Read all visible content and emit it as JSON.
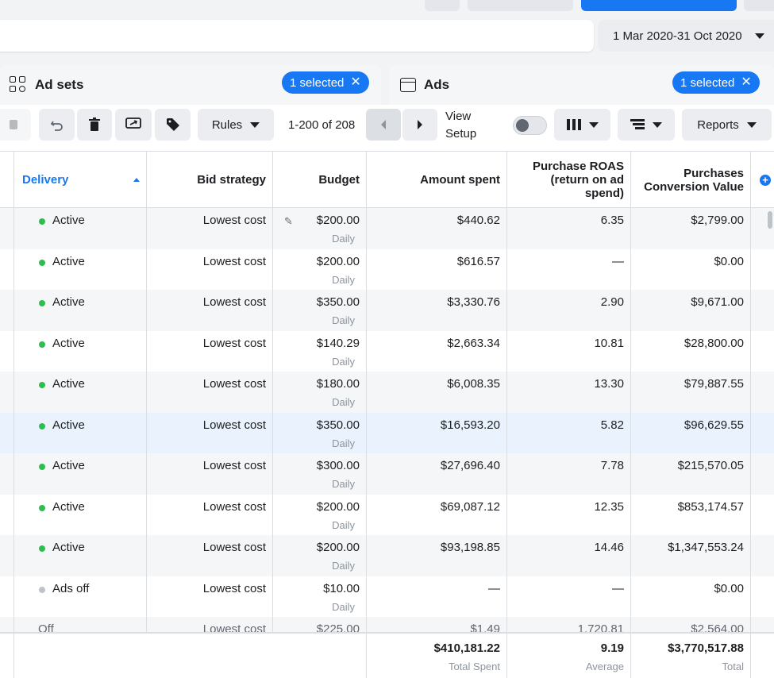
{
  "date_range": {
    "label": "1 Mar 2020-31 Oct 2020"
  },
  "tabs": [
    {
      "label": "Ad sets",
      "icon": "grid-icon",
      "selected_label": "1 selected"
    },
    {
      "label": "Ads",
      "icon": "window-icon",
      "selected_label": "1 selected"
    }
  ],
  "toolbar": {
    "rules_label": "Rules",
    "pager_label": "1-200 of 208",
    "view_setup_line1": "View",
    "view_setup_line2": "Setup",
    "reports_label": "Reports"
  },
  "table": {
    "columns": [
      "Delivery",
      "Bid strategy",
      "Budget",
      "Amount spent",
      "Purchase ROAS (return on ad spend)",
      "Purchases Conversion Value"
    ],
    "rows": [
      {
        "delivery": "Active",
        "status": "active",
        "bid": "Lowest cost",
        "budget": "$200.00",
        "budget_type": "Daily",
        "spent": "$440.62",
        "roas": "6.35",
        "value": "$2,799.00"
      },
      {
        "delivery": "Active",
        "status": "active",
        "bid": "Lowest cost",
        "budget": "$200.00",
        "budget_type": "Daily",
        "spent": "$616.57",
        "roas": "—",
        "value": "$0.00"
      },
      {
        "delivery": "Active",
        "status": "active",
        "bid": "Lowest cost",
        "budget": "$350.00",
        "budget_type": "Daily",
        "spent": "$3,330.76",
        "roas": "2.90",
        "value": "$9,671.00"
      },
      {
        "delivery": "Active",
        "status": "active",
        "bid": "Lowest cost",
        "budget": "$140.29",
        "budget_type": "Daily",
        "spent": "$2,663.34",
        "roas": "10.81",
        "value": "$28,800.00"
      },
      {
        "delivery": "Active",
        "status": "active",
        "bid": "Lowest cost",
        "budget": "$180.00",
        "budget_type": "Daily",
        "spent": "$6,008.35",
        "roas": "13.30",
        "value": "$79,887.55"
      },
      {
        "delivery": "Active",
        "status": "active",
        "bid": "Lowest cost",
        "budget": "$350.00",
        "budget_type": "Daily",
        "spent": "$16,593.20",
        "roas": "5.82",
        "value": "$96,629.55"
      },
      {
        "delivery": "Active",
        "status": "active",
        "bid": "Lowest cost",
        "budget": "$300.00",
        "budget_type": "Daily",
        "spent": "$27,696.40",
        "roas": "7.78",
        "value": "$215,570.05"
      },
      {
        "delivery": "Active",
        "status": "active",
        "bid": "Lowest cost",
        "budget": "$200.00",
        "budget_type": "Daily",
        "spent": "$69,087.12",
        "roas": "12.35",
        "value": "$853,174.57"
      },
      {
        "delivery": "Active",
        "status": "active",
        "bid": "Lowest cost",
        "budget": "$200.00",
        "budget_type": "Daily",
        "spent": "$93,198.85",
        "roas": "14.46",
        "value": "$1,347,553.24"
      },
      {
        "delivery": "Ads off",
        "status": "off",
        "bid": "Lowest cost",
        "budget": "$10.00",
        "budget_type": "Daily",
        "spent": "—",
        "roas": "—",
        "value": "$0.00"
      },
      {
        "delivery": "Off",
        "status": "none",
        "bid": "Lowest cost",
        "budget": "$225.00",
        "budget_type": "",
        "spent": "$1.49",
        "roas": "1,720.81",
        "value": "$2,564.00"
      }
    ],
    "totals": {
      "spent": "$410,181.22",
      "spent_label": "Total Spent",
      "roas": "9.19",
      "roas_label": "Average",
      "value": "$3,770,517.88",
      "value_label": "Total"
    }
  },
  "colors": {
    "accent": "#1877f2",
    "active_dot": "#2dbe4f",
    "off_dot": "#bec3c9",
    "highlight_row": "#eaf3fd"
  }
}
